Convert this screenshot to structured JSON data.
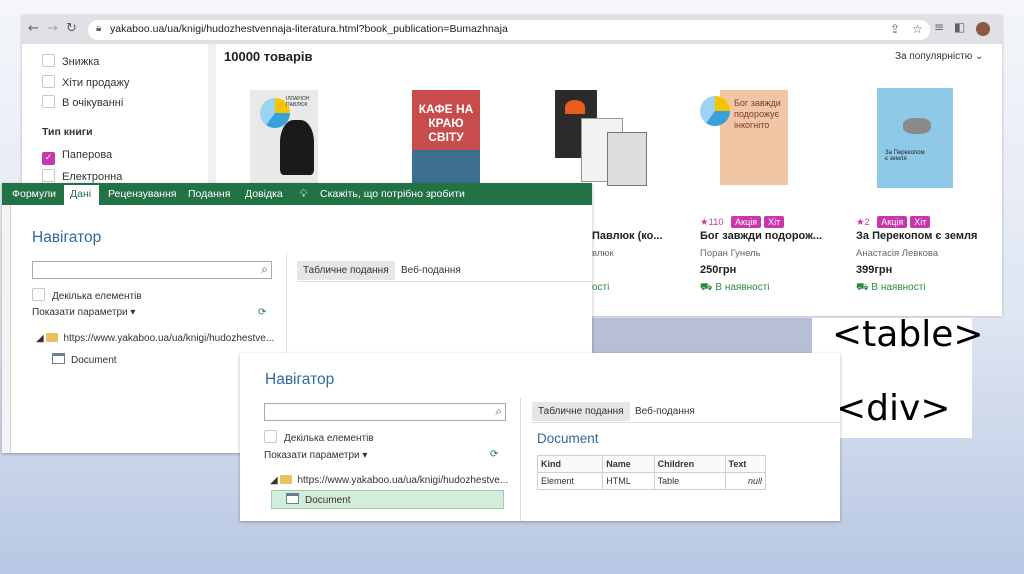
{
  "browser": {
    "url": "yakaboo.ua/ua/knigi/hudozhestvennaja-literatura.html?book_publication=Bumazhnaja",
    "sidebar": {
      "items": [
        {
          "label": "Знижка",
          "checked": false
        },
        {
          "label": "Хіти продажу",
          "checked": false
        },
        {
          "label": "В очікуванні",
          "checked": false
        }
      ],
      "group_title": "Тип книги",
      "type_items": [
        {
          "label": "Паперова",
          "checked": true
        },
        {
          "label": "Електронна",
          "checked": false
        }
      ]
    },
    "results_count": "10000 товарів",
    "sort_label": "За популярністю",
    "cards": [
      {
        "title": "Павлюк (ко...",
        "author": "влюк",
        "stock": "ості"
      },
      {
        "rating": "110",
        "tags": [
          "Акція",
          "Хіт"
        ],
        "title": "Бог завжди подорож...",
        "author": "Поран Гунель",
        "price": "250грн",
        "stock": "В наявності"
      },
      {
        "rating": "2",
        "tags": [
          "Акція",
          "Хіт"
        ],
        "title": "За Перекопом є земля",
        "author": "Анастасія Левкова",
        "price": "399грн",
        "stock": "В наявності"
      }
    ],
    "covers": [
      {
        "text": "ІЛЛАРІОН ПАВЛЮК",
        "bg": "#e9e9e9"
      },
      {
        "text": "КАФЕ НА КРАЮ СВІТУ",
        "bg": "#c94c4c"
      },
      {
        "text": "",
        "bg": "#2b2b2b"
      },
      {
        "text": "Бог завжди подорожує інкогніто",
        "bg": "#f0c6a4"
      },
      {
        "text": "За Перекопом є земля",
        "bg": "#8fc9e8"
      }
    ]
  },
  "excel": {
    "tabs": [
      "Формули",
      "Дані",
      "Рецензування",
      "Подання",
      "Довідка"
    ],
    "tell_me": "Скажіть, що потрібно зробити",
    "navigator_title": "Навігатор",
    "multi_select": "Декілька елементів",
    "show_params": "Показати параметри",
    "tree_url": "https://www.yakaboo.ua/ua/knigi/hudozhestve...",
    "tree_doc": "Document",
    "view_tabs": [
      "Табличне подання",
      "Веб-подання"
    ]
  },
  "navigator2": {
    "title": "Навігатор",
    "multi_select": "Декілька елементів",
    "show_params": "Показати параметри",
    "tree_url": "https://www.yakaboo.ua/ua/knigi/hudozhestve...",
    "tree_doc": "Document",
    "view_tabs": [
      "Табличне подання",
      "Веб-подання"
    ],
    "preview_title": "Document",
    "preview_headers": [
      "Kind",
      "Name",
      "Children",
      "Text"
    ],
    "preview_row": [
      "Element",
      "HTML",
      "Table",
      "null"
    ]
  },
  "tags": {
    "table": "<table>",
    "div": "<div>"
  },
  "colors": {
    "accent_magenta": "#c837ab",
    "excel_green": "#217346",
    "link_blue": "#2e6aa1"
  }
}
